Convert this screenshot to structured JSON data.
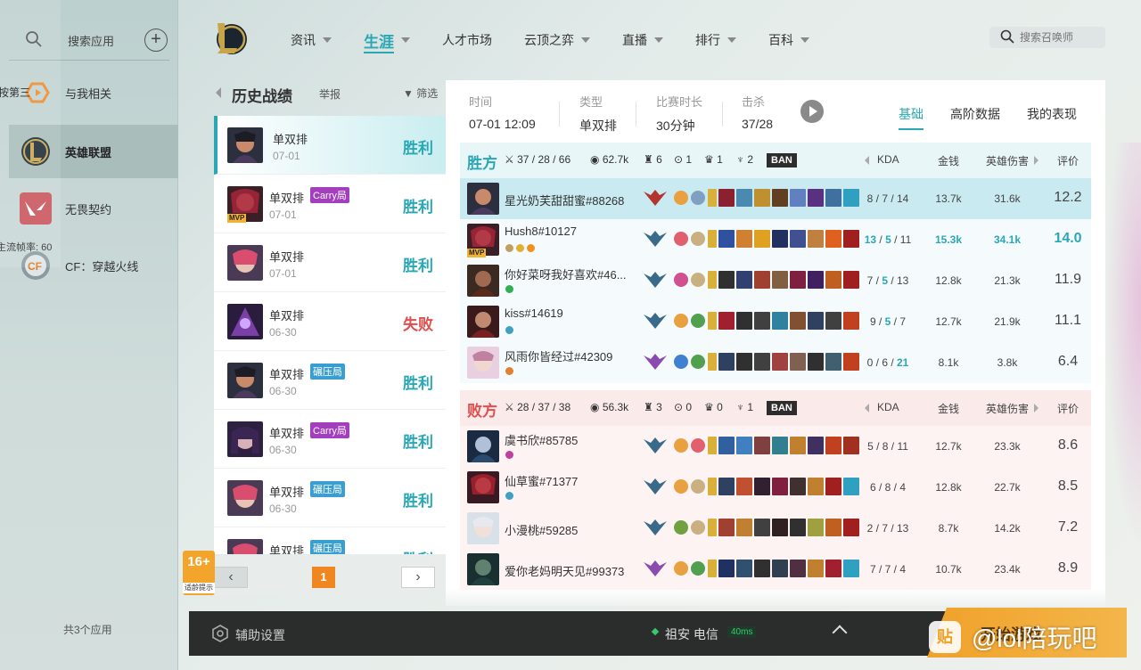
{
  "sidebar": {
    "search_placeholder": "搜索应用",
    "apps": [
      {
        "name": "与我相关"
      },
      {
        "name": "英雄联盟"
      },
      {
        "name": "无畏契约"
      },
      {
        "name": "CF：穿越火线"
      }
    ],
    "count_text": "共3个应用",
    "overlay_text_1": "按第三",
    "overlay_text_2": "主流帧率: 60"
  },
  "nav": {
    "items": [
      {
        "label": "资讯",
        "has_menu": true
      },
      {
        "label": "生涯",
        "has_menu": true,
        "active": true
      },
      {
        "label": "人才市场",
        "has_menu": false
      },
      {
        "label": "云顶之弈",
        "has_menu": true
      },
      {
        "label": "直播",
        "has_menu": true
      },
      {
        "label": "排行",
        "has_menu": true
      },
      {
        "label": "百科",
        "has_menu": true
      }
    ],
    "search_placeholder": "搜索召唤师"
  },
  "history": {
    "title": "历史战绩",
    "report": "举报",
    "filter": "筛选",
    "matches": [
      {
        "mode": "单双排",
        "tag": "",
        "date": "07-01",
        "result": "胜利",
        "win": true,
        "mvp": false
      },
      {
        "mode": "单双排",
        "tag": "Carry局",
        "date": "07-01",
        "result": "胜利",
        "win": true,
        "mvp": true
      },
      {
        "mode": "单双排",
        "tag": "",
        "date": "07-01",
        "result": "胜利",
        "win": true,
        "mvp": false
      },
      {
        "mode": "单双排",
        "tag": "",
        "date": "06-30",
        "result": "失败",
        "win": false,
        "mvp": false
      },
      {
        "mode": "单双排",
        "tag": "碾压局",
        "date": "06-30",
        "result": "胜利",
        "win": true,
        "mvp": false
      },
      {
        "mode": "单双排",
        "tag": "Carry局",
        "date": "06-30",
        "result": "胜利",
        "win": true,
        "mvp": false
      },
      {
        "mode": "单双排",
        "tag": "碾压局",
        "date": "06-30",
        "result": "胜利",
        "win": true,
        "mvp": false
      },
      {
        "mode": "单双排",
        "tag": "碾压局",
        "date": "",
        "result": "胜利",
        "win": true,
        "mvp": false
      }
    ],
    "page": "1",
    "age_rating": "16+",
    "age_note": "适龄提示"
  },
  "summary": {
    "time_label": "时间",
    "time": "07-01 12:09",
    "type_label": "类型",
    "type": "单双排",
    "duration_label": "比赛时长",
    "duration": "30分钟",
    "kills_label": "击杀",
    "kills": "37/28",
    "tabs": [
      "基础",
      "高阶数据",
      "我的表现"
    ]
  },
  "columns": {
    "kda": "KDA",
    "gold": "金钱",
    "damage": "英雄伤害",
    "score": "评价"
  },
  "teams": [
    {
      "name": "胜方",
      "kda": "37 / 28 / 66",
      "gold": "62.7k",
      "towers": "6",
      "inhibitors": "1",
      "barons": "1",
      "dragons": "2",
      "ban": "BAN",
      "players": [
        {
          "name": "星光奶芙甜甜蜜#88268",
          "kda": "8 / 7 / 14",
          "gold": "13.7k",
          "damage": "31.6k",
          "score": "12.2",
          "highlight": true,
          "mvp": false
        },
        {
          "name": "Hush8#10127",
          "kda": "13 / 5 / 11",
          "gold": "15.3k",
          "damage": "34.1k",
          "score": "14.0",
          "top": true,
          "mvp": true
        },
        {
          "name": "你好菜呀我好喜欢#46...",
          "kda": "7 / 5 / 13",
          "gold": "12.8k",
          "damage": "21.3k",
          "score": "11.9"
        },
        {
          "name": "kiss#14619",
          "kda": "9 / 5 / 7",
          "gold": "12.7k",
          "damage": "21.9k",
          "score": "11.1"
        },
        {
          "name": "风雨你皆经过#42309",
          "kda": "0 / 6 / 21",
          "gold": "8.1k",
          "damage": "3.8k",
          "score": "6.4"
        }
      ]
    },
    {
      "name": "败方",
      "kda": "28 / 37 / 38",
      "gold": "56.3k",
      "towers": "3",
      "inhibitors": "0",
      "barons": "0",
      "dragons": "1",
      "ban": "BAN",
      "players": [
        {
          "name": "虞书欣#85785",
          "kda": "5 / 8 / 11",
          "gold": "12.7k",
          "damage": "23.3k",
          "score": "8.6"
        },
        {
          "name": "仙草蜜#71377",
          "kda": "6 / 8 / 4",
          "gold": "12.8k",
          "damage": "22.7k",
          "score": "8.5"
        },
        {
          "name": "小漫桃#59285",
          "kda": "2 / 7 / 13",
          "gold": "8.7k",
          "damage": "14.2k",
          "score": "7.2"
        },
        {
          "name": "爱你老妈明天见#99373",
          "kda": "7 / 7 / 4",
          "gold": "10.7k",
          "damage": "23.4k",
          "score": "8.9"
        }
      ]
    }
  ],
  "bottom": {
    "assist": "辅助设置",
    "server": "祖安 电信",
    "ping": "40ms",
    "start": "开始游戏",
    "watermark": "@lol陪玩吧",
    "watermark_icon": "贴"
  },
  "colors": {
    "accent": "#2aa7b5",
    "loss": "#e04e4e",
    "orange": "#f0861f",
    "carry": "#a33fbf",
    "stomp": "#3a9fd0"
  }
}
